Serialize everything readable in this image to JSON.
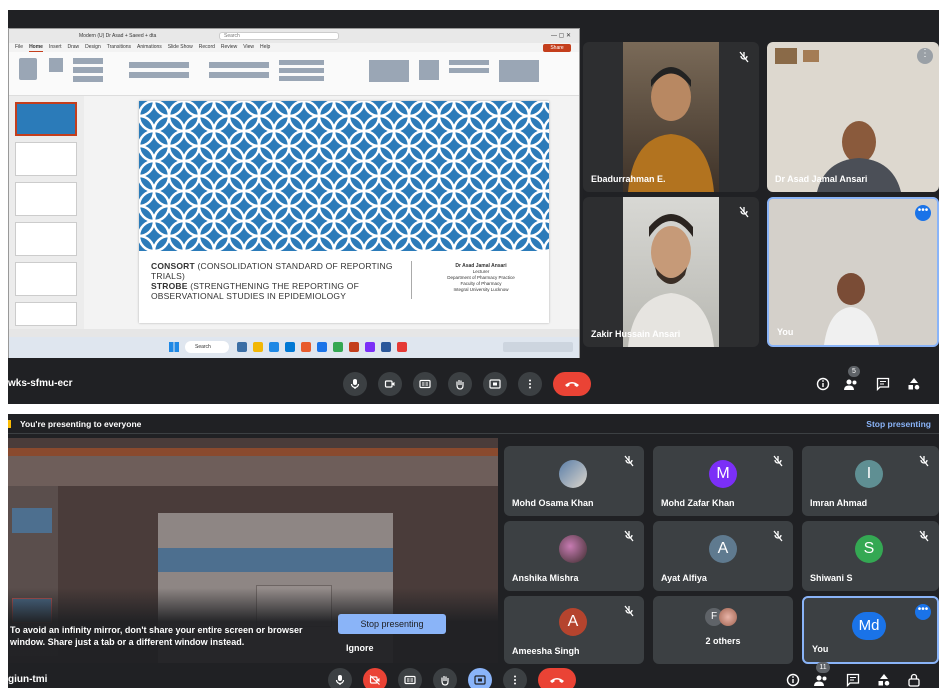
{
  "top": {
    "meeting_code": "wks-sfmu-ecr",
    "ppt": {
      "search_placeholder": "Search",
      "title": "Modern (U) Dr Asad + Saeed + dta",
      "ribbon_tabs": [
        "File",
        "Home",
        "Insert",
        "Draw",
        "Design",
        "Transitions",
        "Animations",
        "Slide Show",
        "Record",
        "Review",
        "View",
        "Help"
      ],
      "share_label": "Share",
      "slide_title_line1_bold": "CONSORT",
      "slide_title_line1_rest": "(CONSOLIDATION STANDARD OF REPORTING TRIALS)",
      "slide_title_line2_bold": "STROBE",
      "slide_title_line2_rest": "(STRENGTHENING THE REPORTING OF OBSERVATIONAL STUDIES IN EPIDEMIOLOGY",
      "author_name": "Dr Asad Jamal Ansari",
      "author_role": "Lecturer",
      "author_dept": "Department of Pharmacy Practice",
      "author_faculty": "Faculty of Pharmacy",
      "author_uni": "Integral University Lucknow",
      "taskbar_search": "Search"
    },
    "participants": [
      {
        "name": "Ebadurrahman E."
      },
      {
        "name": "Dr Asad Jamal Ansari"
      },
      {
        "name": "Zakir Hussain Ansari"
      },
      {
        "name": "You"
      }
    ],
    "people_count": "5"
  },
  "bottom": {
    "banner_text": "You're presenting to everyone",
    "stop_link": "Stop presenting",
    "infinity_warning": "To avoid an infinity mirror, don't share your entire screen or browser window. Share just a tab or a different window instead.",
    "stop_button": "Stop presenting",
    "ignore_button": "Ignore",
    "meeting_code": "giun-tmi",
    "people_count": "11",
    "participants": [
      {
        "name": "Mohd Osama Khan",
        "initial": ""
      },
      {
        "name": "Mohd Zafar Khan",
        "initial": "M"
      },
      {
        "name": "Imran Ahmad",
        "initial": "I"
      },
      {
        "name": "Anshika Mishra",
        "initial": ""
      },
      {
        "name": "Ayat Alfiya",
        "initial": "A"
      },
      {
        "name": "Shiwani S",
        "initial": "S"
      },
      {
        "name": "Ameesha Singh",
        "initial": "A"
      },
      {
        "name": "2 others",
        "initial": "F"
      },
      {
        "name": "You",
        "initial": "Md"
      }
    ]
  },
  "colors": {
    "meet_bg": "#202124",
    "tile_bg": "#3c4043",
    "accent_blue": "#1a73e8",
    "end_red": "#ea4335",
    "slide_blue": "#2b7bb9"
  }
}
